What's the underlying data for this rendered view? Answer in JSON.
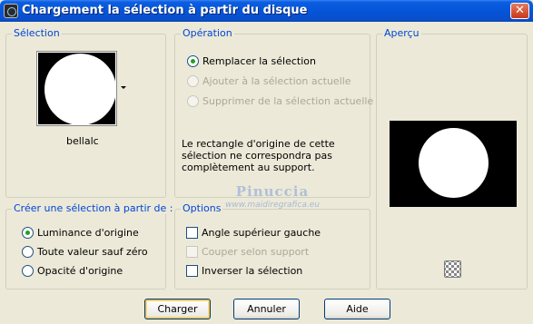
{
  "window": {
    "title": "Chargement la sélection à partir du disque",
    "close_glyph": "✕"
  },
  "selection": {
    "label": "Sélection",
    "shape_name": "bellalc"
  },
  "operation": {
    "label": "Opération",
    "options": [
      {
        "label": "Remplacer la sélection",
        "checked": true,
        "enabled": true
      },
      {
        "label": "Ajouter à la sélection actuelle",
        "checked": false,
        "enabled": false
      },
      {
        "label": "Supprimer de la sélection actuelle",
        "checked": false,
        "enabled": false
      }
    ],
    "note": "Le rectangle d'origine de cette sélection ne correspondra pas complètement au support."
  },
  "preview": {
    "label": "Aperçu"
  },
  "create": {
    "label": "Créer une sélection à partir de :",
    "options": [
      {
        "label": "Luminance d'origine",
        "checked": true
      },
      {
        "label": "Toute valeur sauf zéro",
        "checked": false
      },
      {
        "label": "Opacité d'origine",
        "checked": false
      }
    ]
  },
  "options": {
    "label": "Options",
    "items": [
      {
        "label": "Angle supérieur gauche",
        "checked": false,
        "enabled": true
      },
      {
        "label": "Couper selon support",
        "checked": false,
        "enabled": false
      },
      {
        "label": "Inverser la sélection",
        "checked": false,
        "enabled": true
      }
    ]
  },
  "buttons": {
    "load": "Charger",
    "cancel": "Annuler",
    "help": "Aide"
  },
  "watermark": {
    "name": "Pinuccia",
    "url": "www.maidiregrafica.eu"
  },
  "icons": {
    "proof": "proof-checkerboard-icon",
    "dropdown": "chevron-down-icon",
    "app": "app-icon"
  }
}
